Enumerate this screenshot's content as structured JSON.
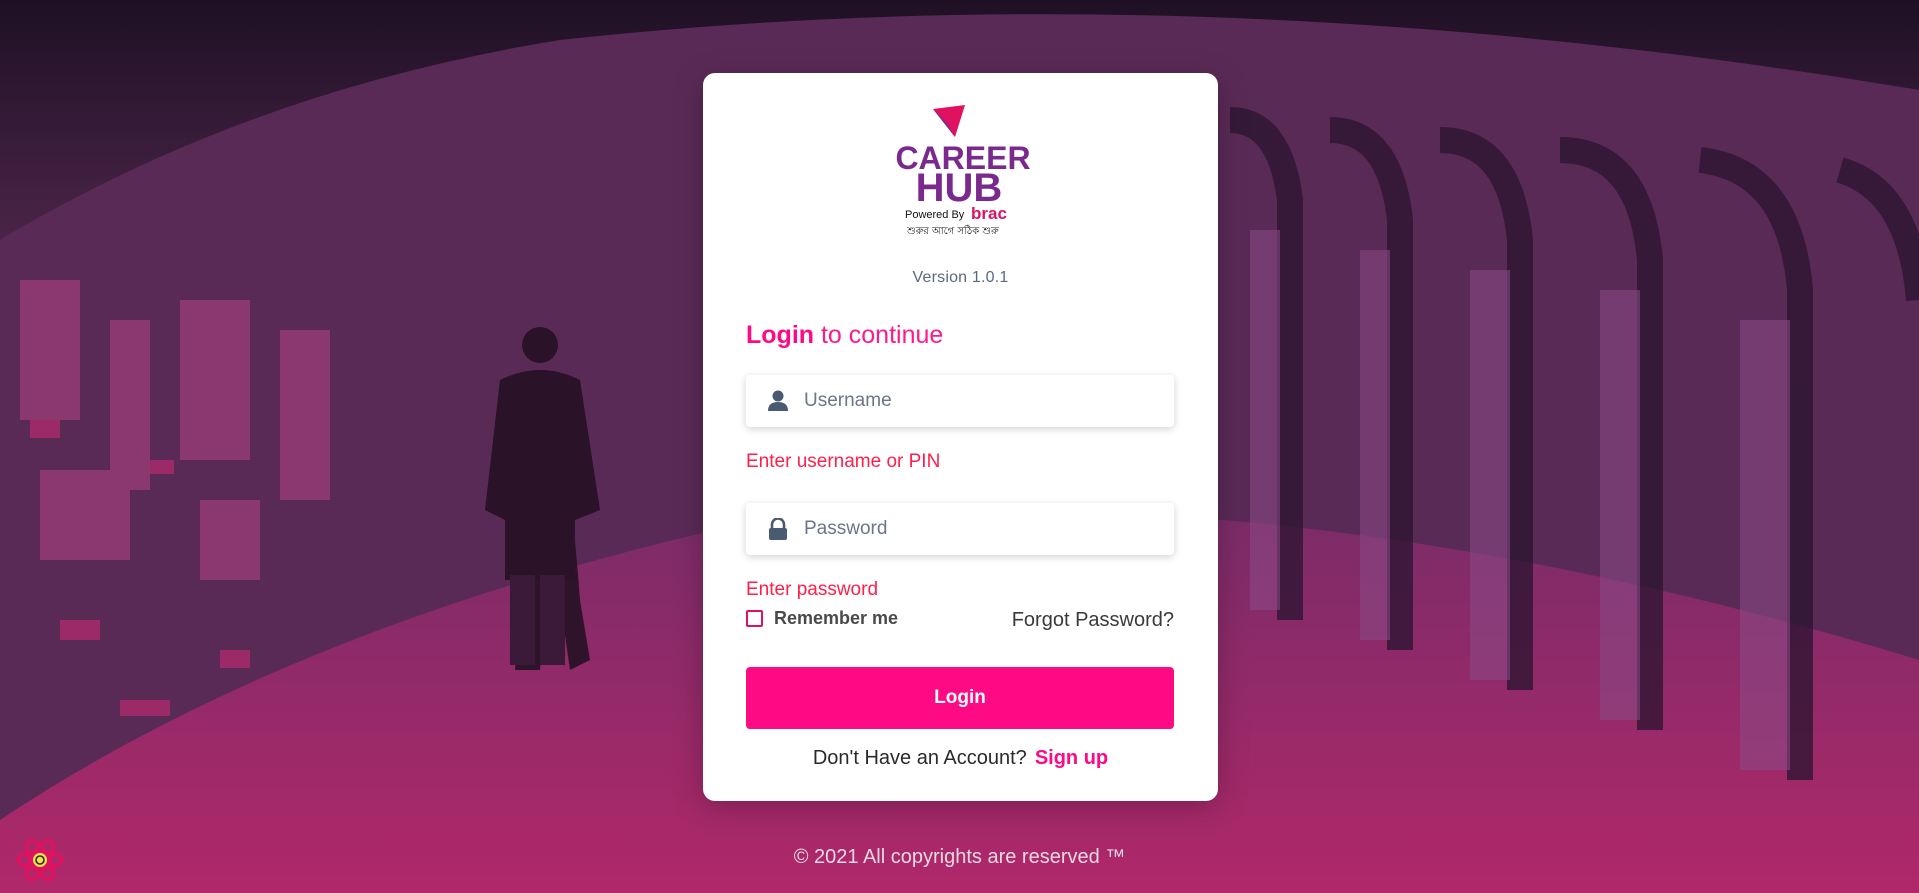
{
  "app": {
    "brand_title_line1": "CAREER",
    "brand_title_line2": "HUB",
    "brand_powered_by": "Powered By",
    "brand_powered_name": "brac",
    "brand_tagline": "শুরুর আগে সঠিক শুরু",
    "version": "Version 1.0.1"
  },
  "login_form": {
    "heading_strong": "Login",
    "heading_rest": " to continue",
    "username_placeholder": "Username",
    "username_value": "",
    "username_error": "Enter username or PIN",
    "password_placeholder": "Password",
    "password_value": "",
    "password_error": "Enter password",
    "remember_label": "Remember me",
    "remember_checked": false,
    "forgot_label": "Forgot Password?",
    "submit_label": "Login",
    "signup_prompt": "Don't Have an Account?",
    "signup_label": "Sign up"
  },
  "footer": {
    "copyright": "© 2021 All copyrights are reserved ™"
  },
  "icons": {
    "username": "user-icon",
    "password": "lock-icon",
    "devtools": "react-icon"
  },
  "colors": {
    "accent": "#ff0a85",
    "error": "#ff1f4b",
    "brand_purple": "#7a2a8c",
    "brand_pink": "#e0115f"
  }
}
